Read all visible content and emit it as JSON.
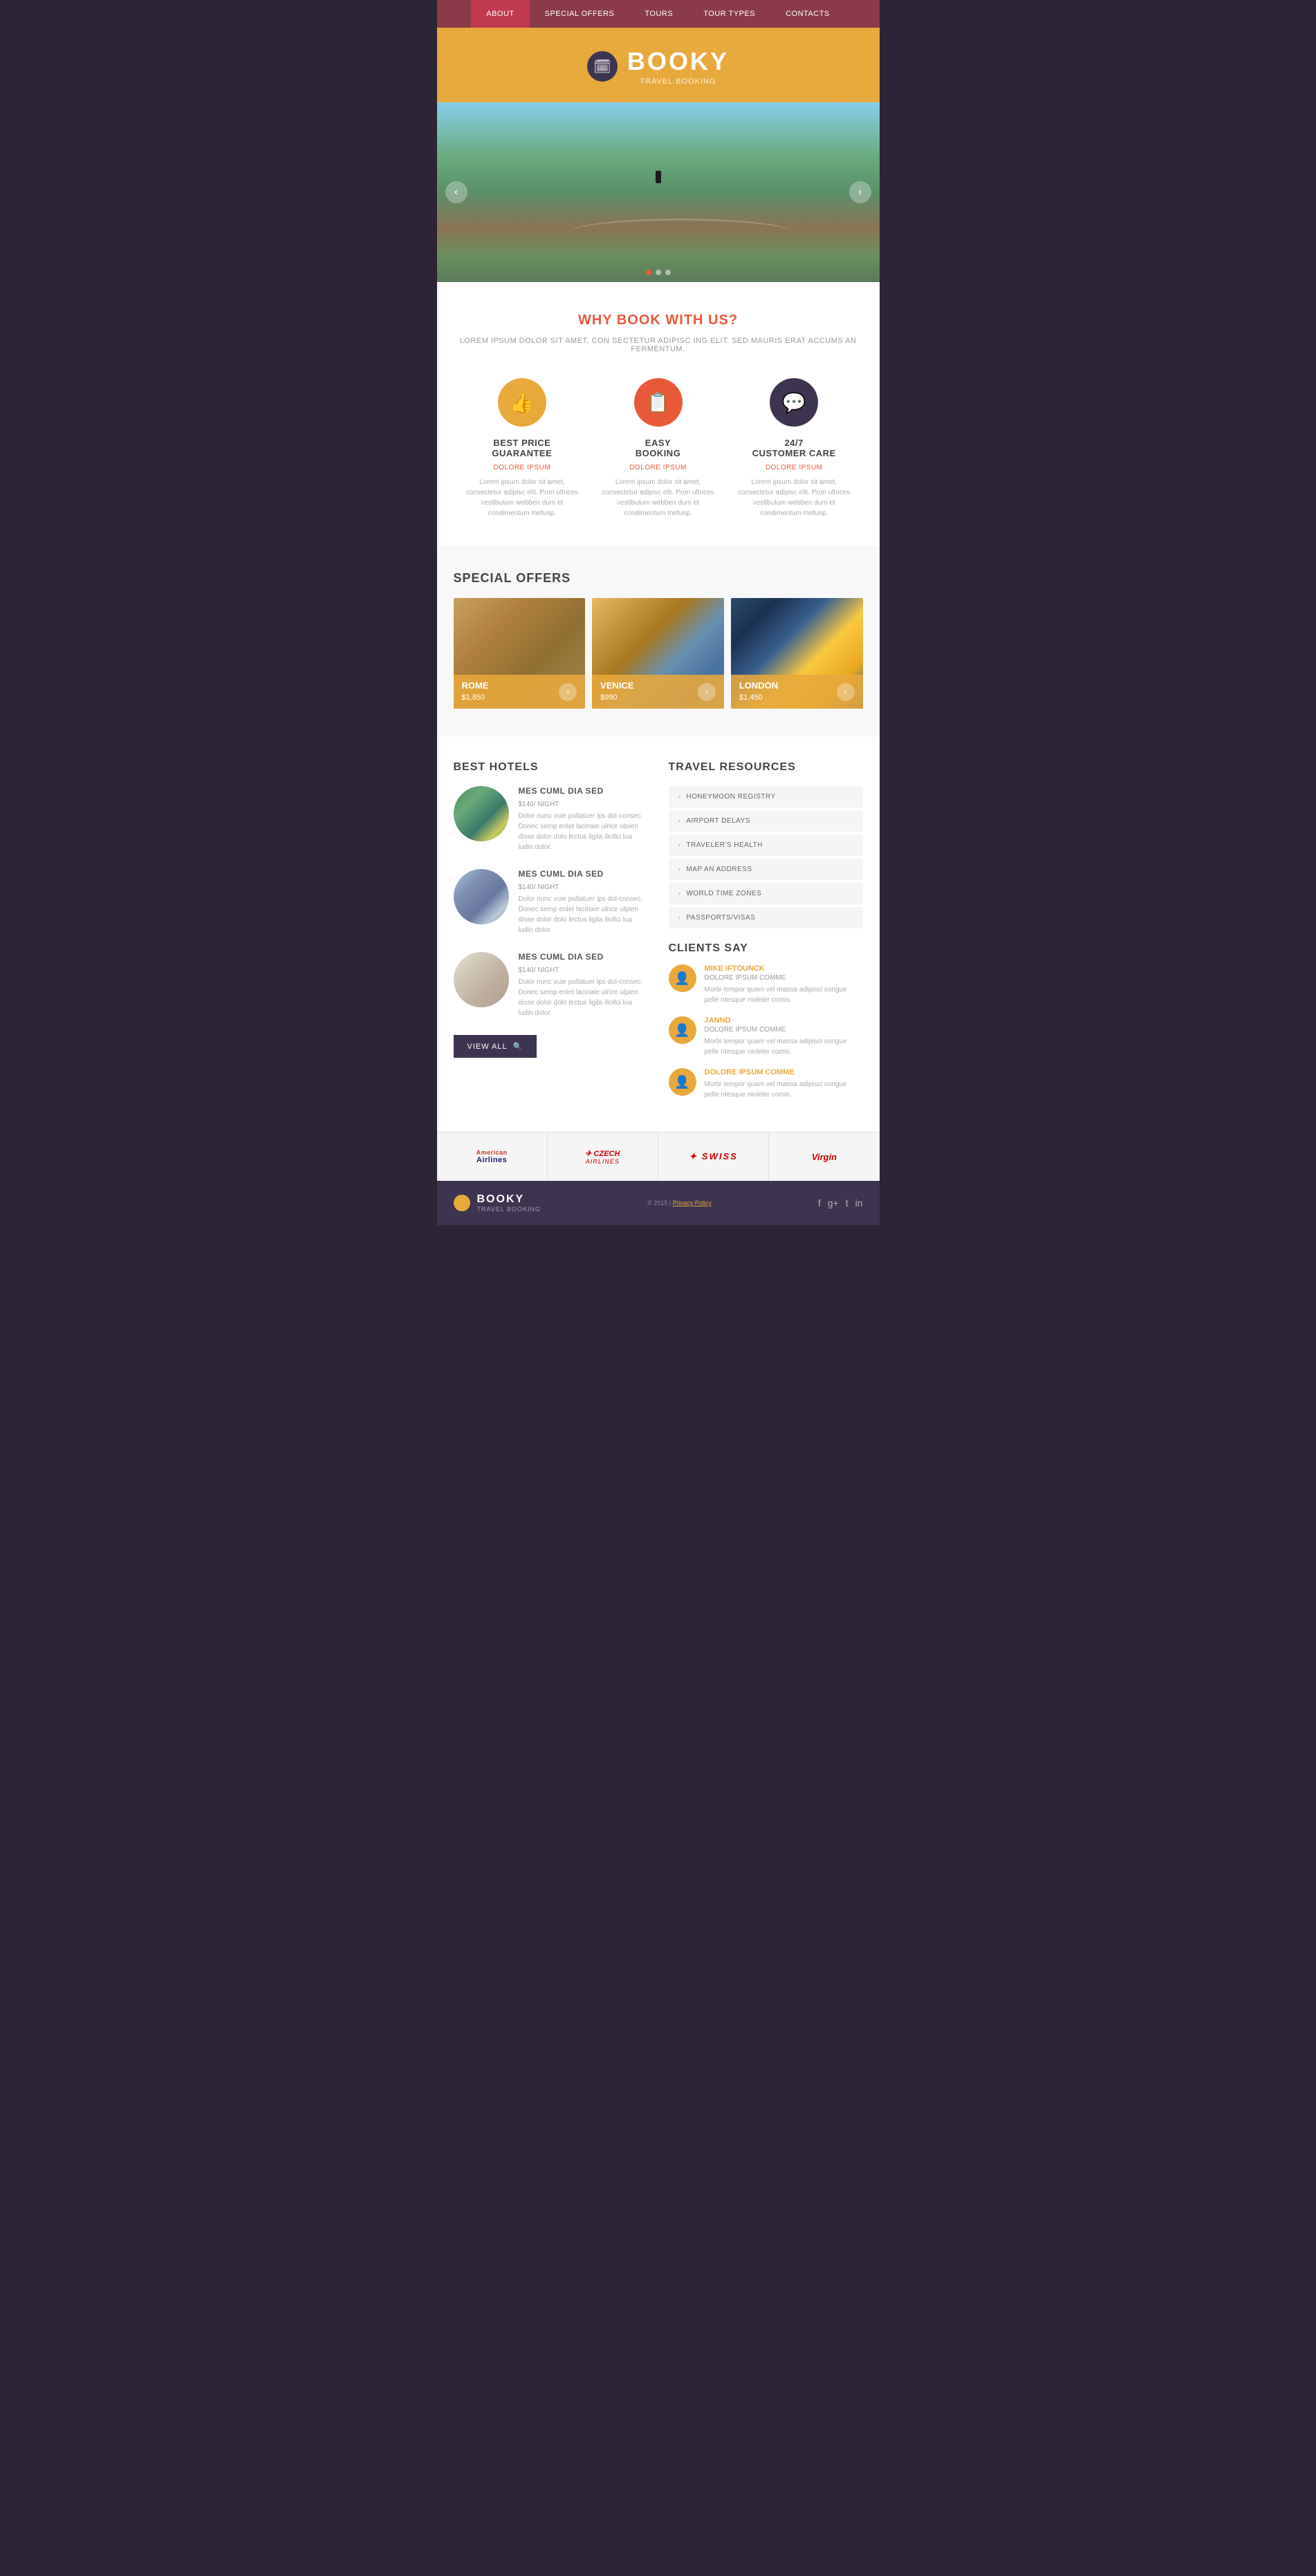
{
  "nav": {
    "items": [
      {
        "label": "ABOUT",
        "active": true
      },
      {
        "label": "SPECIAL OFFERS",
        "active": false
      },
      {
        "label": "TOURS",
        "active": false
      },
      {
        "label": "TOUR TYPES",
        "active": false
      },
      {
        "label": "CONTACTS",
        "active": false
      }
    ]
  },
  "header": {
    "title": "BOOKY",
    "subtitle": "TRAVEL BOOKING",
    "icon": "📅"
  },
  "slider": {
    "dots": [
      true,
      false,
      false
    ],
    "prev_label": "‹",
    "next_label": "›"
  },
  "why_book": {
    "title": "WHY BOOK WITH US?",
    "subtitle": "LOREM IPSUM DOLOR SIT AMET, CON SECTETUR ADIPISC ING ELIT. SED MAURIS ERAT ACCUMS AN FERMENTUM.",
    "features": [
      {
        "icon": "👍",
        "icon_class": "orange",
        "title": "BEST PRICE\nGUARANTEE",
        "dolore": "DOLORE IPSUM",
        "text": "Lorem ipsum dolor sit amet, consectetur adipisc elit. Pron ultrices vestibulum webben dum et condimentum metusp."
      },
      {
        "icon": "📋",
        "icon_class": "salmon",
        "title": "EASY\nBOOKING",
        "dolore": "DOLORE IPSUM",
        "text": "Lorem ipsum dolor sit amet, consectetur adipisc elit. Pron ultrices vestibulum webben dum et condimentum metusp."
      },
      {
        "icon": "💬",
        "icon_class": "dark",
        "title": "24/7\nCUSTOMER CARE",
        "dolore": "DOLORE IPSUM",
        "text": "Lorem ipsum dolor sit amet, consectetur adipisc elit. Pron ultrices vestibulum webben dum et condimentum metusp."
      }
    ]
  },
  "special_offers": {
    "title": "SPECIAL OFFERS",
    "cards": [
      {
        "city": "ROME",
        "price": "$1,850",
        "img_class": "rome"
      },
      {
        "city": "VENICE",
        "price": "$990",
        "img_class": "venice"
      },
      {
        "city": "LONDON",
        "price": "$1,450",
        "img_class": "london"
      }
    ]
  },
  "best_hotels": {
    "title": "BEST HOTELS",
    "hotels": [
      {
        "name": "MES CUML DIA SED",
        "price": "$140",
        "per": "/ NIGHT",
        "text": "Dolor nunc vuie pullatuer ips dol-consec. Donec semp enlet lacinaie ulrice ulpien disse dolor dolo lectus ligila iliollci lua ludin dolor.",
        "img_class": "h1"
      },
      {
        "name": "MES CUML DIA SED",
        "price": "$140",
        "per": "/ NIGHT",
        "text": "Dolor nunc vuie pullatuer ips dol-consec. Donec semp enlet lacinaie ulrice ulpien disse dolor dolo lectus ligila iliollci lua ludin dolor.",
        "img_class": "h2"
      },
      {
        "name": "MES CUML DIA SED",
        "price": "$140",
        "per": "/ NIGHT",
        "text": "Dolor nunc vuie pullatuer ips dol-consec. Donec semp enlet lacinaie ulrice ulpien disse dolor dolo lectus ligila iliollci lua ludin dolor.",
        "img_class": "h3"
      }
    ],
    "view_all": "VIEW ALL"
  },
  "travel_resources": {
    "title": "TRAVEL RESOURCES",
    "items": [
      "HONEYMOON REGISTRY",
      "AIRPORT DELAYS",
      "TRAVELER'S HEALTH",
      "MAP AN ADDRESS",
      "WORLD TIME ZONES",
      "PASSPORTS/VISAS"
    ]
  },
  "clients_say": {
    "title": "CLIENTS SAY",
    "testimonials": [
      {
        "name": "MIKE IFTOUNCK",
        "role": "DOLORE IPSUM COMME",
        "text": "Morbi tempor quam vel massa adipisci congue pelle ntesque nioleler comis."
      },
      {
        "name": "JANND",
        "role": "DOLORE IPSUM COMME",
        "text": "Morbi tempor quam vel massa adipisci congue pelle ntesque nioleler comis."
      },
      {
        "name": "DOLORE IPSUM COMME",
        "role": "",
        "text": "Morbi tempor quam vel massa adipisci congue pelle ntesque nioleler comis."
      }
    ]
  },
  "airlines": [
    {
      "name": "American Airlines",
      "style": "american"
    },
    {
      "name": "Czech Airlines",
      "style": "czech"
    },
    {
      "name": "SWISS",
      "style": "swiss"
    },
    {
      "name": "Virgin",
      "style": "virgin"
    }
  ],
  "footer": {
    "brand": "BOOKY",
    "subtitle": "TRAVEL BOOKING",
    "copyright": "© 2015 |",
    "privacy_link": "Privacy Policy",
    "social": [
      "f",
      "g+",
      "t",
      "in"
    ]
  }
}
